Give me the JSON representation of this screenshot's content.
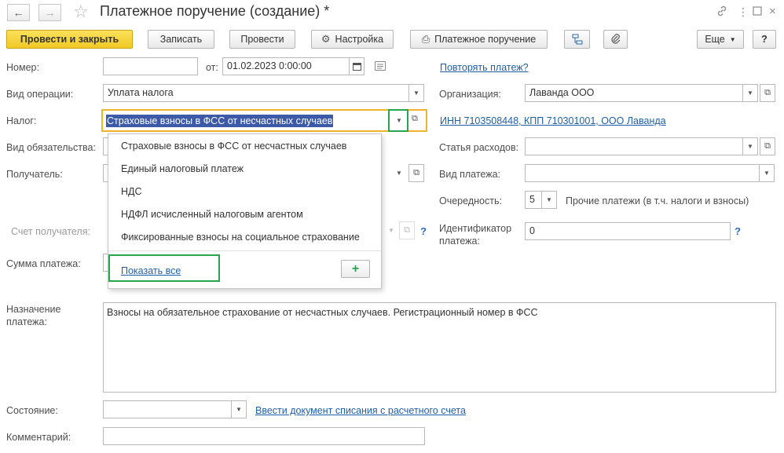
{
  "window": {
    "title": "Платежное поручение (создание) *"
  },
  "toolbar": {
    "post_close": "Провести и закрыть",
    "save": "Записать",
    "post": "Провести",
    "settings": "Настройка",
    "print_order": "Платежное поручение",
    "more": "Еще",
    "help": "?"
  },
  "form": {
    "number_label": "Номер:",
    "number_value": "",
    "from_label": "от:",
    "date_value": "01.02.2023  0:00:00",
    "repeat_link": "Повторять платеж?",
    "operation_label": "Вид операции:",
    "operation_value": "Уплата налога",
    "org_label": "Организация:",
    "org_value": "Лаванда ООО",
    "tax_label": "Налог:",
    "tax_value": "Страховые взносы в ФСС от несчастных случаев",
    "inn_link": "ИНН 7103508448, КПП 710301001, ООО Лаванда",
    "obligation_label": "Вид обязательства:",
    "expense_label": "Статья расходов:",
    "expense_value": "",
    "recipient_label": "Получатель:",
    "payment_type_label": "Вид платежа:",
    "payment_type_value": "",
    "priority_label": "Очередность:",
    "priority_value": "5",
    "priority_desc": "Прочие платежи (в т.ч. налоги и взносы)",
    "account_label": "Счет получателя:",
    "identifier_label_1": "Идентификатор",
    "identifier_label_2": "платежа:",
    "identifier_value": "0",
    "identifier_help": "?",
    "account_help": "?",
    "sum_label": "Сумма платежа:",
    "purpose_label_1": "Назначение",
    "purpose_label_2": "платежа:",
    "purpose_value": "Взносы на обязательное страхование от несчастных случаев. Регистрационный номер в ФСС",
    "status_label": "Состояние:",
    "status_value": "",
    "writeoff_link": "Ввести документ списания с расчетного счета",
    "comment_label": "Комментарий:",
    "comment_value": ""
  },
  "dropdown": {
    "items": [
      "Страховые взносы в ФСС от несчастных случаев",
      "Единый налоговый платеж",
      "НДС",
      "НДФЛ исчисленный налоговым агентом",
      "Фиксированные взносы на социальное страхование"
    ],
    "show_all": "Показать все"
  },
  "colors": {
    "primary_button": "#f5cf2d",
    "link": "#1f5fa8",
    "selection": "#3c5aa8",
    "highlight_box": "#2aa44f",
    "focus_border": "#f0b429"
  }
}
